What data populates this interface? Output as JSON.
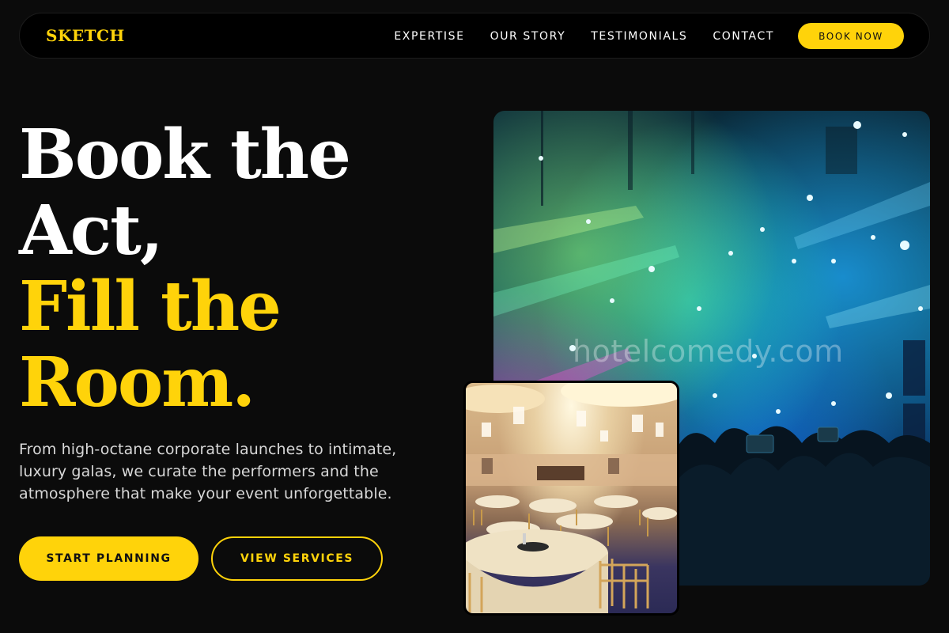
{
  "nav": {
    "logo": "SKETCH",
    "links": [
      {
        "label": "EXPERTISE"
      },
      {
        "label": "OUR STORY"
      },
      {
        "label": "TESTIMONIALS"
      },
      {
        "label": "CONTACT"
      }
    ],
    "cta_label": "BOOK NOW"
  },
  "hero": {
    "headline_lines": [
      "Book the",
      "Act,"
    ],
    "headline_accent_lines": [
      "Fill the",
      "Room."
    ],
    "subtitle": "From high-octane corporate launches to intimate, luxury galas, we curate the performers and the atmosphere that make your event unforgettable.",
    "primary_button": "START PLANNING",
    "secondary_button": "VIEW SERVICES"
  },
  "images": {
    "concert_watermark": "hotelcomedy.com"
  },
  "colors": {
    "accent": "#ffd30a",
    "background": "#0b0b0b",
    "nav_background": "#000000"
  }
}
